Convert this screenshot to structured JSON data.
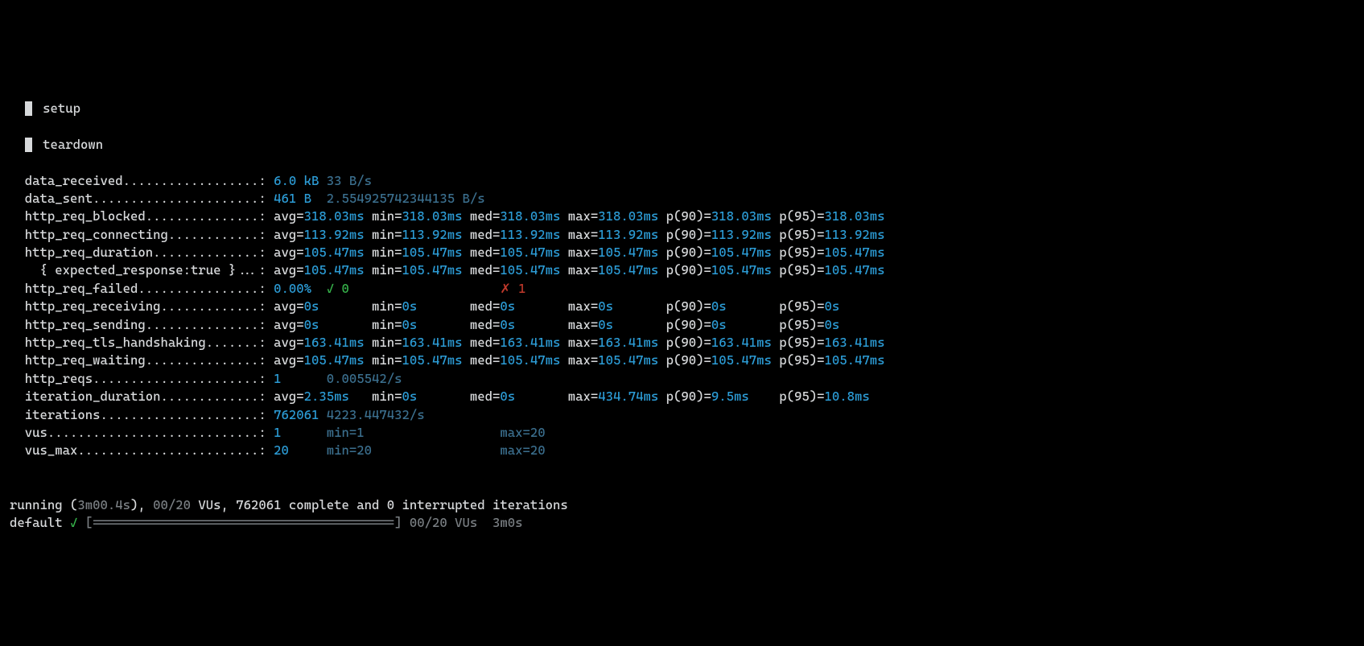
{
  "sections": {
    "setup": "setup",
    "teardown": "teardown"
  },
  "metrics": {
    "data_received": {
      "name": "data_received",
      "value": "6.0 kB",
      "rate": "33 B/s"
    },
    "data_sent": {
      "name": "data_sent",
      "value": "461 B",
      "rate": "2.554925742344135 B/s"
    },
    "http_req_blocked": {
      "name": "http_req_blocked",
      "avg": "318.03ms",
      "min": "318.03ms",
      "med": "318.03ms",
      "max": "318.03ms",
      "p90": "318.03ms",
      "p95": "318.03ms"
    },
    "http_req_connecting": {
      "name": "http_req_connecting",
      "avg": "113.92ms",
      "min": "113.92ms",
      "med": "113.92ms",
      "max": "113.92ms",
      "p90": "113.92ms",
      "p95": "113.92ms"
    },
    "http_req_duration": {
      "name": "http_req_duration",
      "avg": "105.47ms",
      "min": "105.47ms",
      "med": "105.47ms",
      "max": "105.47ms",
      "p90": "105.47ms",
      "p95": "105.47ms"
    },
    "expected_response": {
      "name": "{ expected_response:true }",
      "avg": "105.47ms",
      "min": "105.47ms",
      "med": "105.47ms",
      "max": "105.47ms",
      "p90": "105.47ms",
      "p95": "105.47ms"
    },
    "http_req_failed": {
      "name": "http_req_failed",
      "pct": "0.00%",
      "check": "✓",
      "passed": "0",
      "cross": "✗",
      "failed": "1"
    },
    "http_req_receiving": {
      "name": "http_req_receiving",
      "avg": "0s",
      "min": "0s",
      "med": "0s",
      "max": "0s",
      "p90": "0s",
      "p95": "0s"
    },
    "http_req_sending": {
      "name": "http_req_sending",
      "avg": "0s",
      "min": "0s",
      "med": "0s",
      "max": "0s",
      "p90": "0s",
      "p95": "0s"
    },
    "http_req_tls": {
      "name": "http_req_tls_handshaking",
      "avg": "163.41ms",
      "min": "163.41ms",
      "med": "163.41ms",
      "max": "163.41ms",
      "p90": "163.41ms",
      "p95": "163.41ms"
    },
    "http_req_waiting": {
      "name": "http_req_waiting",
      "avg": "105.47ms",
      "min": "105.47ms",
      "med": "105.47ms",
      "max": "105.47ms",
      "p90": "105.47ms",
      "p95": "105.47ms"
    },
    "http_reqs": {
      "name": "http_reqs",
      "value": "1",
      "rate": "0.005542/s"
    },
    "iteration_duration": {
      "name": "iteration_duration",
      "avg": "2.35ms",
      "min": "0s",
      "med": "0s",
      "max": "434.74ms",
      "p90": "9.5ms",
      "p95": "10.8ms"
    },
    "iterations": {
      "name": "iterations",
      "value": "762061",
      "rate": "4223.447432/s"
    },
    "vus": {
      "name": "vus",
      "value": "1",
      "min": "min=1",
      "max": "max=20"
    },
    "vus_max": {
      "name": "vus_max",
      "value": "20",
      "min": "min=20",
      "max": "max=20"
    }
  },
  "progress": {
    "running_label": "running",
    "elapsed": "3m00.4s",
    "active_vus": "00/20",
    "vus_label": "VUs",
    "complete": "762061 complete and 0 interrupted iterations",
    "scenario": "default",
    "check": "✓",
    "bar": "[========================================]",
    "bar_vus": "00/20 VUs",
    "bar_time": "3m0s"
  }
}
